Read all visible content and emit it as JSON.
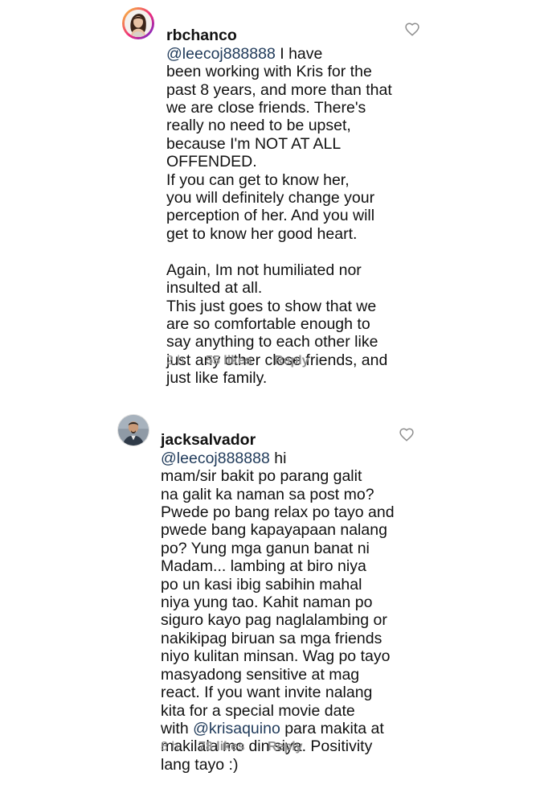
{
  "comments": [
    {
      "username": "rbchanco",
      "mention": "@leecoj888888",
      "body": " I have\nbeen working with Kris for the\npast 8 years, and more than that\nwe are close friends. There's\nreally no need to be upset,\nbecause I'm NOT AT ALL\nOFFENDED.\nIf you can get to know her,\nyou will definitely change your\nperception of her. And you will\nget to know her good heart.\n\nAgain, Im not humiliated nor\ninsulted at all.\nThis just goes to show that we\nare so comfortable enough to\nsay anything to each other like\njust any other close friends, and\njust like family.",
      "time": "2 h",
      "likes": "55 likes",
      "reply": "Reply",
      "avatar_icon": "woman-portrait-avatar",
      "like_icon": "heart-outline-icon"
    },
    {
      "username": "jacksalvador",
      "mention": "@leecoj888888",
      "body_part1": " hi\nmam/sir bakit po parang galit\nna galit ka naman sa post mo?\nPwede po bang relax po tayo and\npwede bang kapayapaan nalang\npo? Yung mga ganun banat ni\nMadam... lambing at biro niya\npo un kasi ibig sabihin mahal\nniya yung tao. Kahit naman po\nsiguro kayo pag naglalambing or\nnakikipag biruan sa mga friends\nniyo kulitan minsan. Wag po tayo\nmasyadong sensitive at mag\nreact. If you want invite nalang\nkita for a special movie date\nwith ",
      "mention2": "@krisaquino",
      "body_part2": " para makita at\nmakilala mo din siya. Positivity\nlang tayo :)",
      "time": "8 h",
      "likes": "78 likes",
      "reply": "Reply",
      "avatar_icon": "man-portrait-avatar",
      "like_icon": "heart-outline-icon"
    }
  ],
  "colors": {
    "mention": "#1f3a5a",
    "meta": "#8e8e8e",
    "text": "#111111"
  }
}
